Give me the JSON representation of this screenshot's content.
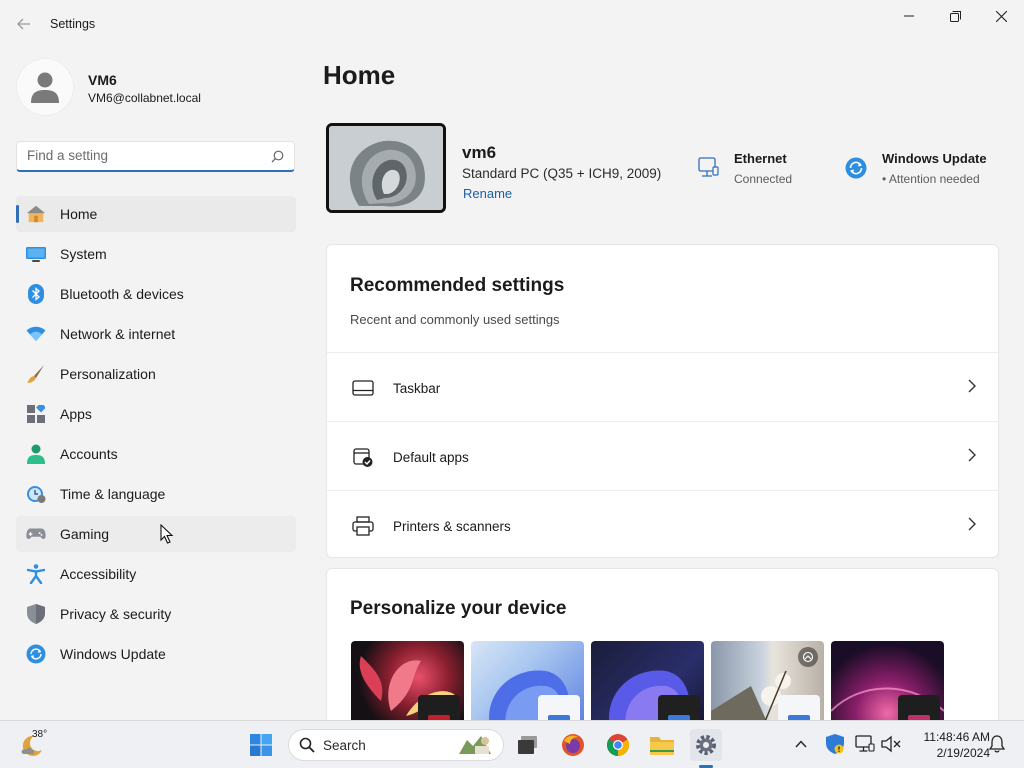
{
  "window": {
    "title": "Settings",
    "controls": {
      "minimize": "minimize",
      "maximize": "maximize",
      "close": "close"
    }
  },
  "profile": {
    "name": "VM6",
    "email": "VM6@collabnet.local"
  },
  "search": {
    "placeholder": "Find a setting"
  },
  "nav": {
    "items": [
      {
        "label": "Home",
        "icon": "home-icon",
        "active": true
      },
      {
        "label": "System",
        "icon": "system-icon"
      },
      {
        "label": "Bluetooth & devices",
        "icon": "bluetooth-icon"
      },
      {
        "label": "Network & internet",
        "icon": "wifi-icon"
      },
      {
        "label": "Personalization",
        "icon": "brush-icon"
      },
      {
        "label": "Apps",
        "icon": "apps-icon"
      },
      {
        "label": "Accounts",
        "icon": "accounts-icon"
      },
      {
        "label": "Time & language",
        "icon": "clock-globe-icon"
      },
      {
        "label": "Gaming",
        "icon": "gamepad-icon",
        "hover": true
      },
      {
        "label": "Accessibility",
        "icon": "accessibility-icon"
      },
      {
        "label": "Privacy & security",
        "icon": "shield-icon"
      },
      {
        "label": "Windows Update",
        "icon": "update-icon"
      }
    ]
  },
  "main": {
    "title": "Home",
    "device": {
      "name": "vm6",
      "model": "Standard PC (Q35 + ICH9, 2009)",
      "rename": "Rename"
    },
    "status": {
      "ethernet": {
        "title": "Ethernet",
        "sub": "Connected"
      },
      "update": {
        "title": "Windows Update",
        "sub": "Attention needed"
      }
    },
    "recommended": {
      "title": "Recommended settings",
      "subtitle": "Recent and commonly used settings",
      "rows": [
        {
          "label": "Taskbar",
          "icon": "taskbar-icon"
        },
        {
          "label": "Default apps",
          "icon": "default-apps-icon"
        },
        {
          "label": "Printers & scanners",
          "icon": "printer-icon"
        }
      ]
    },
    "personalize": {
      "title": "Personalize your device"
    }
  },
  "taskbar": {
    "temperature": "38°",
    "search_label": "Search",
    "time": "11:48:46 AM",
    "date": "2/19/2024"
  },
  "colors": {
    "accent": "#2f6fb5",
    "link": "#1d5ea8"
  }
}
